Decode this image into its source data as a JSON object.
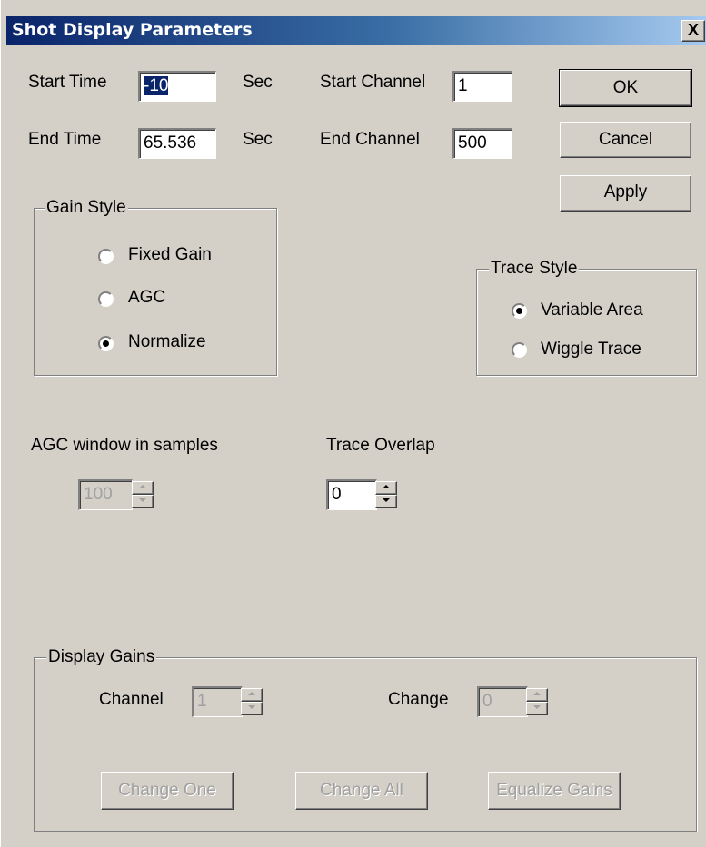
{
  "window": {
    "title": "Shot Display Parameters",
    "close_label": "X"
  },
  "fields": {
    "start_time_label": "Start Time",
    "start_time_value": "-10",
    "start_time_unit": "Sec",
    "end_time_label": "End Time",
    "end_time_value": "65.536",
    "end_time_unit": "Sec",
    "start_channel_label": "Start Channel",
    "start_channel_value": "1",
    "end_channel_label": "End Channel",
    "end_channel_value": "500"
  },
  "buttons": {
    "ok": "OK",
    "cancel": "Cancel",
    "apply": "Apply"
  },
  "gain_style": {
    "title": "Gain Style",
    "options": [
      {
        "label": "Fixed Gain",
        "selected": false
      },
      {
        "label": "AGC",
        "selected": false
      },
      {
        "label": "Normalize",
        "selected": true
      }
    ]
  },
  "trace_style": {
    "title": "Trace Style",
    "options": [
      {
        "label": "Variable Area",
        "selected": true
      },
      {
        "label": "Wiggle Trace",
        "selected": false
      }
    ]
  },
  "agc_window": {
    "label": "AGC window in samples",
    "value": "100",
    "enabled": false
  },
  "trace_overlap": {
    "label": "Trace Overlap",
    "value": "0",
    "enabled": true
  },
  "display_gains": {
    "title": "Display Gains",
    "channel_label": "Channel",
    "channel_value": "1",
    "change_label": "Change",
    "change_value": "0",
    "change_one": "Change One",
    "change_all": "Change All",
    "equalize": "Equalize Gains"
  }
}
